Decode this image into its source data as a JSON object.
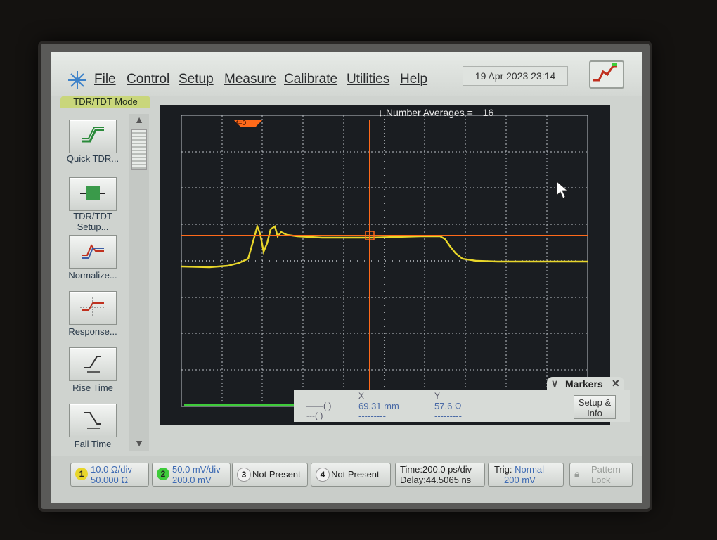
{
  "menu": {
    "items": [
      "File",
      "Control",
      "Setup",
      "Measure",
      "Calibrate",
      "Utilities",
      "Help"
    ],
    "datetime": "19 Apr 2023  23:14"
  },
  "mode_tab": "TDR/TDT Mode",
  "tools": [
    {
      "label": "Quick TDR...",
      "icon": "quick-tdr-icon"
    },
    {
      "label": "TDR/TDT Setup...",
      "icon": "tdr-setup-icon"
    },
    {
      "label": "Normalize...",
      "icon": "normalize-icon"
    },
    {
      "label": "Response...",
      "icon": "response-icon"
    },
    {
      "label": "Rise Time",
      "icon": "rise-time-icon"
    },
    {
      "label": "Fall Time",
      "icon": "fall-time-icon"
    }
  ],
  "display": {
    "num_averages_label": "Number Averages =",
    "num_averages_value": "16",
    "t0_label": "t=0",
    "colors": {
      "trace": "#e8d62a",
      "marker": "#ff6a1a",
      "grid": "#dde3e8",
      "ground": "#3ecb3a"
    }
  },
  "markers": {
    "title": "Markers",
    "x_head": "X",
    "y_head": "Y",
    "x_value": "69.31 mm",
    "y_value": "57.6 Ω",
    "row1_symbol": "——( )",
    "row2_symbol": "---( )",
    "row2_x": "---------",
    "row2_y": "---------",
    "setup_label": "Setup & Info"
  },
  "bottom": {
    "ch1": {
      "num": "1",
      "line1": "10.0 Ω/div",
      "line2": "50.000 Ω",
      "color": "#e8d62a"
    },
    "ch2": {
      "num": "2",
      "line1": "50.0 mV/div",
      "line2": "200.0 mV",
      "color": "#3ecb3a"
    },
    "ch3": {
      "num": "3",
      "text": "Not Present"
    },
    "ch4": {
      "num": "4",
      "text": "Not Present"
    },
    "time": {
      "line1": "Time:200.0 ps/div",
      "line2": "Delay:44.5065 ns"
    },
    "trig": {
      "line1_label": "Trig:",
      "line1_value": "Normal",
      "line2": "200 mV"
    },
    "pattern_lock": "Pattern Lock"
  }
}
